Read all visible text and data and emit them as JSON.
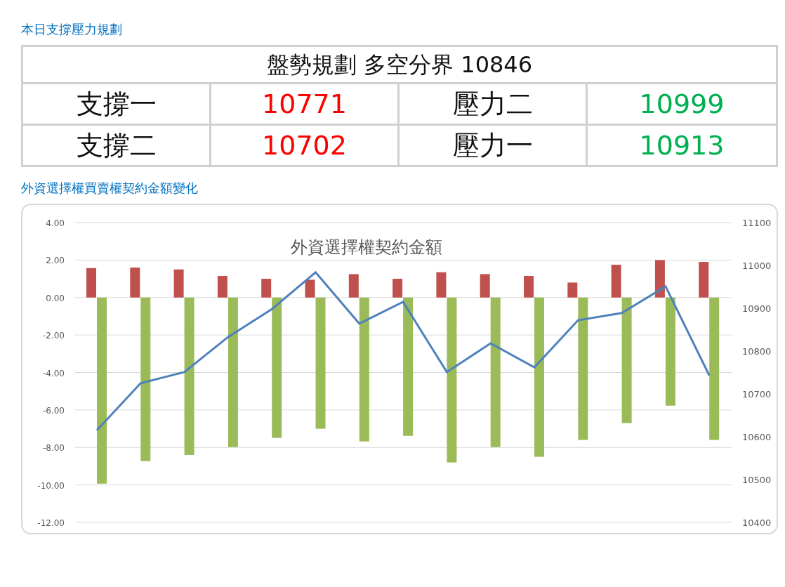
{
  "plan_title": "本日支撐壓力規劃",
  "plan_table": {
    "header": "盤勢規劃 多空分界 10846",
    "rows": [
      [
        {
          "text": "支撐一",
          "kind": "label"
        },
        {
          "text": "10771",
          "kind": "support"
        },
        {
          "text": "壓力二",
          "kind": "label"
        },
        {
          "text": "10999",
          "kind": "resistance"
        }
      ],
      [
        {
          "text": "支撐二",
          "kind": "label"
        },
        {
          "text": "10702",
          "kind": "support"
        },
        {
          "text": "壓力一",
          "kind": "label"
        },
        {
          "text": "10913",
          "kind": "resistance"
        }
      ]
    ]
  },
  "chart_section_title": "外資選擇權買賣權契約金額變化",
  "chart": {
    "chart_data": {
      "type": "bar",
      "stacked": false,
      "grid": true,
      "title": "外資選擇權契約金額",
      "ylim": [
        -12,
        4
      ],
      "y2lim": [
        10400,
        11100
      ],
      "yticks": [
        {
          "value": 4,
          "label": "4.00"
        },
        {
          "value": 2,
          "label": "2.00"
        },
        {
          "value": 0,
          "label": "0.00"
        },
        {
          "value": -2,
          "label": "-2.00"
        },
        {
          "value": -4,
          "label": "-4.00"
        },
        {
          "value": -6,
          "label": "-6.00"
        },
        {
          "value": -8,
          "label": "-8.00"
        },
        {
          "value": -10,
          "label": "-10.00"
        },
        {
          "value": -12,
          "label": "-12.00"
        }
      ],
      "y2ticks": [
        {
          "value": 11100,
          "label": "11100"
        },
        {
          "value": 11000,
          "label": "11000"
        },
        {
          "value": 10900,
          "label": "10900"
        },
        {
          "value": 10800,
          "label": "10800"
        },
        {
          "value": 10700,
          "label": "10700"
        },
        {
          "value": 10600,
          "label": "10600"
        },
        {
          "value": 10500,
          "label": "10500"
        },
        {
          "value": 10400,
          "label": "10400"
        }
      ],
      "series": [
        {
          "color": "#c0504d",
          "values": [
            1.57,
            1.6,
            1.5,
            1.15,
            1.0,
            0.95,
            1.25,
            1.0,
            1.35,
            1.25,
            1.15,
            0.8,
            1.75,
            2.0,
            1.9
          ]
        },
        {
          "color": "#9bbb59",
          "values": [
            -9.93,
            -8.73,
            -8.4,
            -7.98,
            -7.49,
            -7.0,
            -7.68,
            -7.38,
            -8.8,
            -7.98,
            -8.5,
            -7.6,
            -6.7,
            -5.77,
            -7.6
          ]
        },
        {
          "type": "line",
          "axis": "y2",
          "color": "#4f81bd",
          "values": [
            10615,
            10725,
            10751,
            10833,
            10898,
            10984,
            10864,
            10915,
            10751,
            10818,
            10762,
            10872,
            10889,
            10951,
            10743
          ]
        }
      ]
    }
  }
}
